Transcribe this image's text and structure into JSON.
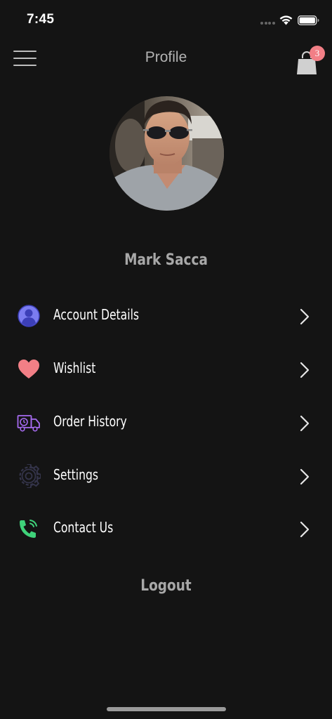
{
  "status_bar": {
    "time": "7:45"
  },
  "nav": {
    "title": "Profile",
    "cart_count": "3"
  },
  "profile": {
    "name": "Mark Sacca"
  },
  "menu": {
    "items": [
      {
        "label": "Account Details",
        "icon": "user-circle-icon",
        "color": "#7b7cf0"
      },
      {
        "label": "Wishlist",
        "icon": "heart-icon",
        "color": "#f27f86"
      },
      {
        "label": "Order History",
        "icon": "delivery-truck-icon",
        "color": "#a66bf0"
      },
      {
        "label": "Settings",
        "icon": "gear-icon",
        "color": "#3a3a4a"
      },
      {
        "label": "Contact Us",
        "icon": "phone-icon",
        "color": "#3fd27a"
      }
    ]
  },
  "logout": {
    "label": "Logout"
  },
  "colors": {
    "background": "#141414",
    "badge": "#f27f86",
    "muted_text": "#a8a8a8"
  }
}
